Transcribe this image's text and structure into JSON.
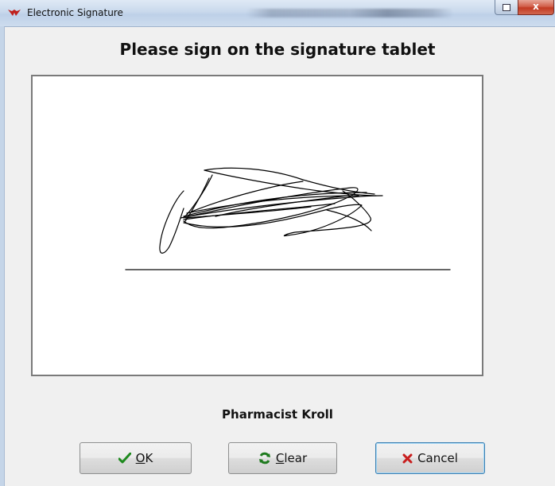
{
  "window": {
    "title": "Electronic Signature",
    "close_glyph": "x"
  },
  "heading": "Please sign on the signature tablet",
  "signer": "Pharmacist Kroll",
  "buttons": {
    "ok": {
      "mnemonic": "O",
      "rest": "K",
      "icon": "check-icon",
      "icon_color": "#1e8a1e"
    },
    "clear": {
      "mnemonic": "C",
      "rest": "lear",
      "icon": "refresh-icon",
      "icon_color": "#1e7a1e"
    },
    "cancel": {
      "label": "Cancel",
      "icon": "x-icon",
      "icon_color": "#c81e1e"
    }
  },
  "colors": {
    "close_button": "#c23a22",
    "titlebar": "#c9d9ec"
  }
}
